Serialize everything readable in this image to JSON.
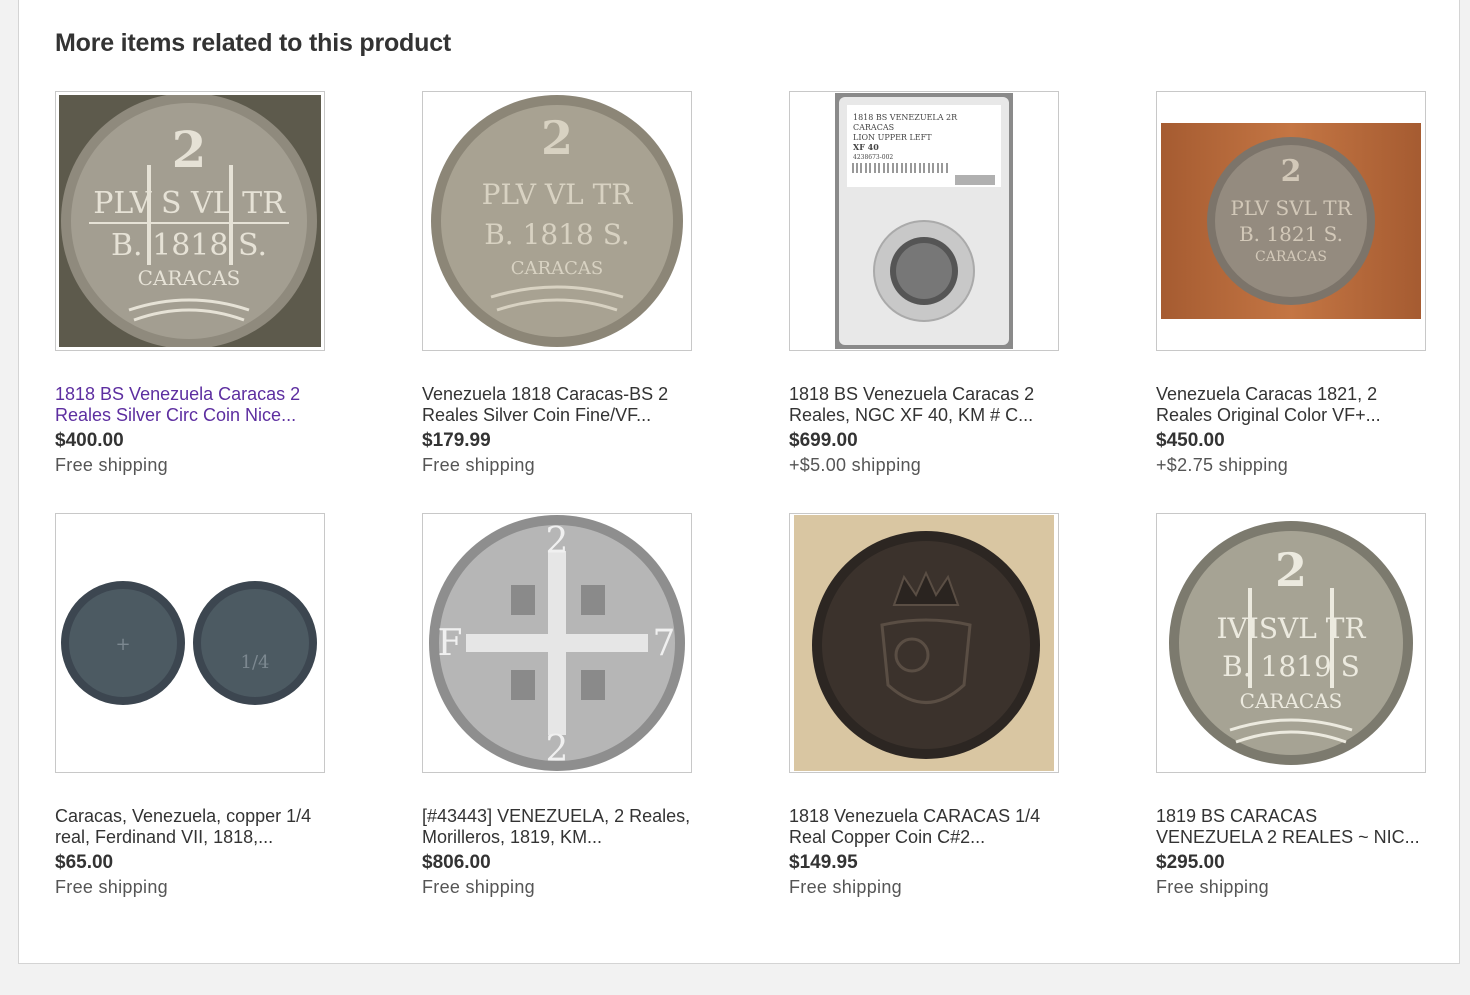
{
  "section": {
    "title": "More items related to this product"
  },
  "items": [
    {
      "title": "1818 BS Venezuela Caracas 2 Reales Silver Circ Coin Nice...",
      "price": "$400.00",
      "shipping": "Free shipping",
      "image": "silver-coin-2-reales-1818-dark-bg",
      "visited": true
    },
    {
      "title": "Venezuela 1818 Caracas-BS 2 Reales Silver Coin Fine/VF...",
      "price": "$179.99",
      "shipping": "Free shipping",
      "image": "silver-coin-2-reales-worn"
    },
    {
      "title": "1818 BS Venezuela Caracas 2 Reales, NGC XF 40, KM # C...",
      "price": "$699.00",
      "shipping": "+$5.00 shipping",
      "image": "ngc-slab-coin",
      "slab_label": [
        "1818 BS VENEZUELA 2R",
        "CARACAS",
        "LION UPPER LEFT",
        "XF 40",
        "4238673-002"
      ]
    },
    {
      "title": "Venezuela Caracas 1821, 2 Reales Original Color VF+...",
      "price": "$450.00",
      "shipping": "+$2.75 shipping",
      "image": "silver-coin-1821-wood-bg"
    },
    {
      "title": "Caracas, Venezuela, copper 1/4 real, Ferdinand VII, 1818,...",
      "price": "$65.00",
      "shipping": "Free shipping",
      "image": "two-copper-coins"
    },
    {
      "title": "[#43443] VENEZUELA, 2 Reales, Morilleros, 1819, KM...",
      "price": "$806.00",
      "shipping": "Free shipping",
      "image": "cross-coin-castles-lions"
    },
    {
      "title": "1818 Venezuela CARACAS 1/4 Real Copper Coin C#2...",
      "price": "$149.95",
      "shipping": "Free shipping",
      "image": "copper-crown-coin"
    },
    {
      "title": "1819 BS CARACAS VENEZUELA 2 REALES ~ NIC...",
      "price": "$295.00",
      "shipping": "Free shipping",
      "image": "silver-coin-1819"
    }
  ]
}
